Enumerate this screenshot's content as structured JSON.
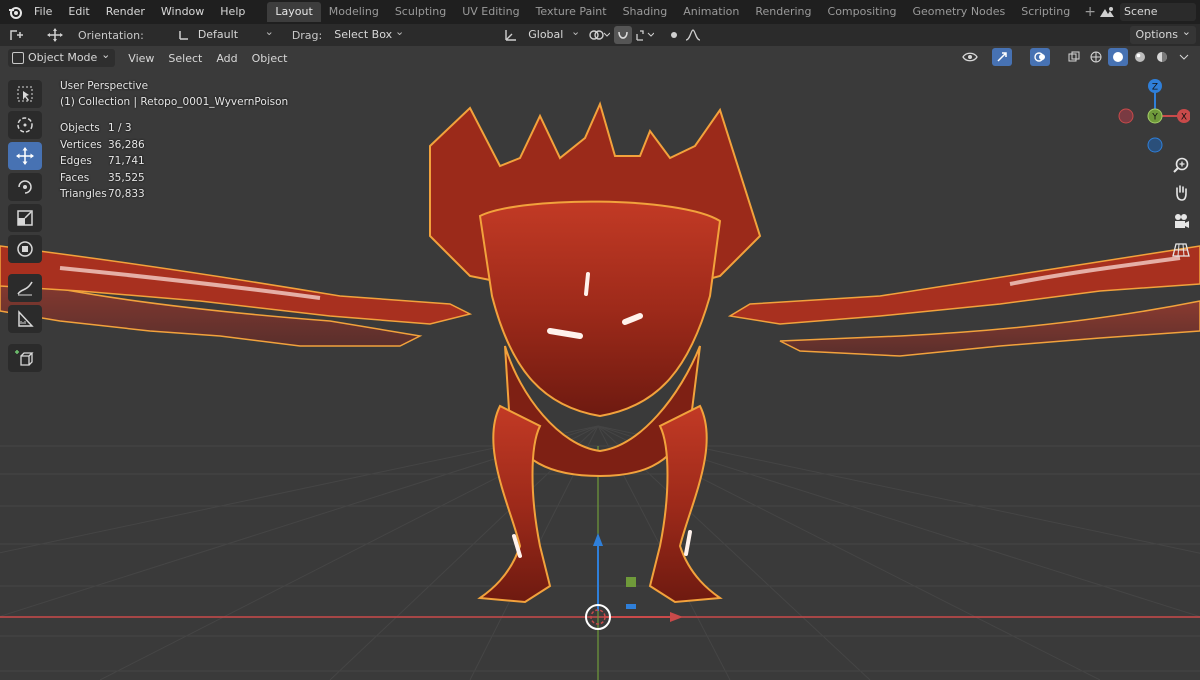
{
  "app": {
    "menu": [
      "File",
      "Edit",
      "Render",
      "Window",
      "Help"
    ],
    "workspaces": [
      {
        "label": "Layout",
        "active": true
      },
      {
        "label": "Modeling"
      },
      {
        "label": "Sculpting"
      },
      {
        "label": "UV Editing"
      },
      {
        "label": "Texture Paint"
      },
      {
        "label": "Shading"
      },
      {
        "label": "Animation"
      },
      {
        "label": "Rendering"
      },
      {
        "label": "Compositing"
      },
      {
        "label": "Geometry Nodes"
      },
      {
        "label": "Scripting"
      }
    ],
    "scene": "Scene"
  },
  "toolheader": {
    "orientation_label": "Orientation:",
    "orientation_value": "Default",
    "drag_label": "Drag:",
    "drag_value": "Select Box",
    "transform_orientation": "Global",
    "options_label": "Options"
  },
  "viewport_header": {
    "mode": "Object Mode",
    "menus": [
      "View",
      "Select",
      "Add",
      "Object"
    ]
  },
  "viewport": {
    "perspective": "User Perspective",
    "collection_line": "(1) Collection | Retopo_0001_WyvernPoison",
    "stats": [
      {
        "label": "Objects",
        "value": "1 / 3"
      },
      {
        "label": "Vertices",
        "value": "36,286"
      },
      {
        "label": "Edges",
        "value": "71,741"
      },
      {
        "label": "Faces",
        "value": "35,525"
      },
      {
        "label": "Triangles",
        "value": "70,833"
      }
    ],
    "gizmo": {
      "x_label": "X",
      "y_label": "Y",
      "z_label": "Z"
    },
    "colors": {
      "background": "#3a3a3a",
      "grid": "#454545",
      "x_axis": "#c94a4a",
      "y_axis": "#6f9a3a",
      "z_axis": "#2f7fd9",
      "selection_outline": "#f2a23c",
      "model": "#b0301e",
      "active_tool": "#4772b3"
    }
  },
  "tools": [
    {
      "name": "select-box-tool"
    },
    {
      "name": "cursor-tool"
    },
    {
      "name": "move-tool",
      "active": true
    },
    {
      "name": "rotate-tool"
    },
    {
      "name": "scale-tool"
    },
    {
      "name": "transform-tool"
    },
    {
      "name": "annotate-tool"
    },
    {
      "name": "measure-tool"
    },
    {
      "name": "add-cube-tool"
    }
  ]
}
